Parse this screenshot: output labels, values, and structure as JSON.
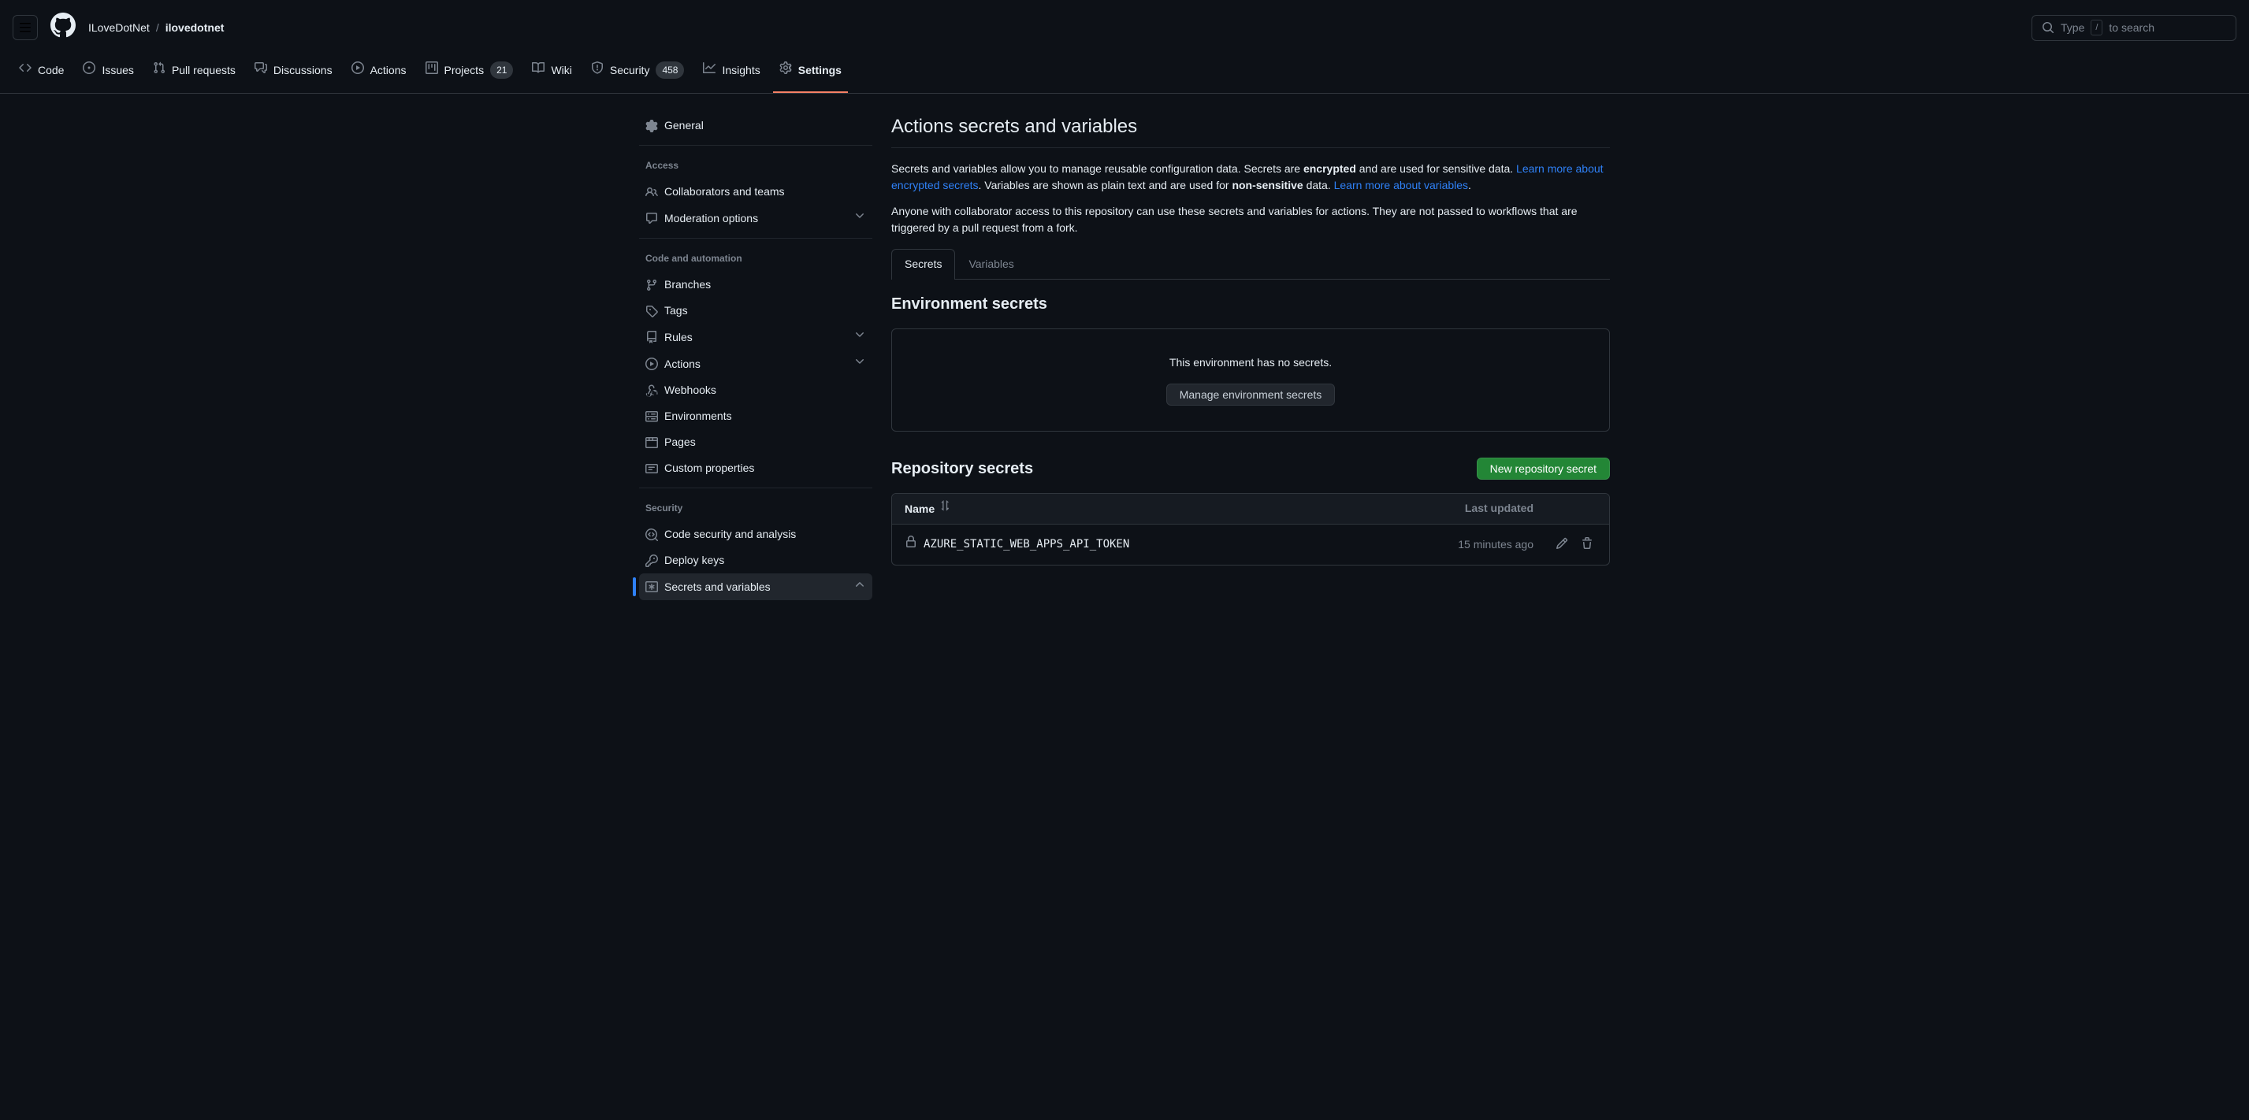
{
  "header": {
    "breadcrumb_owner": "ILoveDotNet",
    "breadcrumb_repo": "ilovedotnet",
    "search_prefix": "Type",
    "search_key": "/",
    "search_suffix": "to search"
  },
  "repo_nav": {
    "code": "Code",
    "issues": "Issues",
    "pull_requests": "Pull requests",
    "discussions": "Discussions",
    "actions": "Actions",
    "projects": "Projects",
    "projects_count": "21",
    "wiki": "Wiki",
    "security": "Security",
    "security_count": "458",
    "insights": "Insights",
    "settings": "Settings"
  },
  "sidebar": {
    "general": "General",
    "access_title": "Access",
    "collaborators": "Collaborators and teams",
    "moderation": "Moderation options",
    "code_auto_title": "Code and automation",
    "branches": "Branches",
    "tags": "Tags",
    "rules": "Rules",
    "actions": "Actions",
    "webhooks": "Webhooks",
    "environments": "Environments",
    "pages": "Pages",
    "custom_properties": "Custom properties",
    "security_title": "Security",
    "code_security": "Code security and analysis",
    "deploy_keys": "Deploy keys",
    "secrets_variables": "Secrets and variables"
  },
  "main": {
    "title": "Actions secrets and variables",
    "desc_p1_a": "Secrets and variables allow you to manage reusable configuration data. Secrets are ",
    "desc_encrypted": "encrypted",
    "desc_p1_b": " and are used for sensitive data. ",
    "link_encrypted": "Learn more about encrypted secrets",
    "desc_p1_c": ". Variables are shown as plain text and are used for ",
    "desc_nonsensitive": "non-sensitive",
    "desc_p1_d": " data. ",
    "link_variables": "Learn more about variables",
    "desc_p2": "Anyone with collaborator access to this repository can use these secrets and variables for actions. They are not passed to workflows that are triggered by a pull request from a fork.",
    "tab_secrets": "Secrets",
    "tab_variables": "Variables",
    "env_heading": "Environment secrets",
    "env_empty": "This environment has no secrets.",
    "env_manage_btn": "Manage environment secrets",
    "repo_heading": "Repository secrets",
    "new_secret_btn": "New repository secret",
    "col_name": "Name",
    "col_updated": "Last updated",
    "secrets": [
      {
        "name": "AZURE_STATIC_WEB_APPS_API_TOKEN",
        "updated": "15 minutes ago"
      }
    ]
  }
}
